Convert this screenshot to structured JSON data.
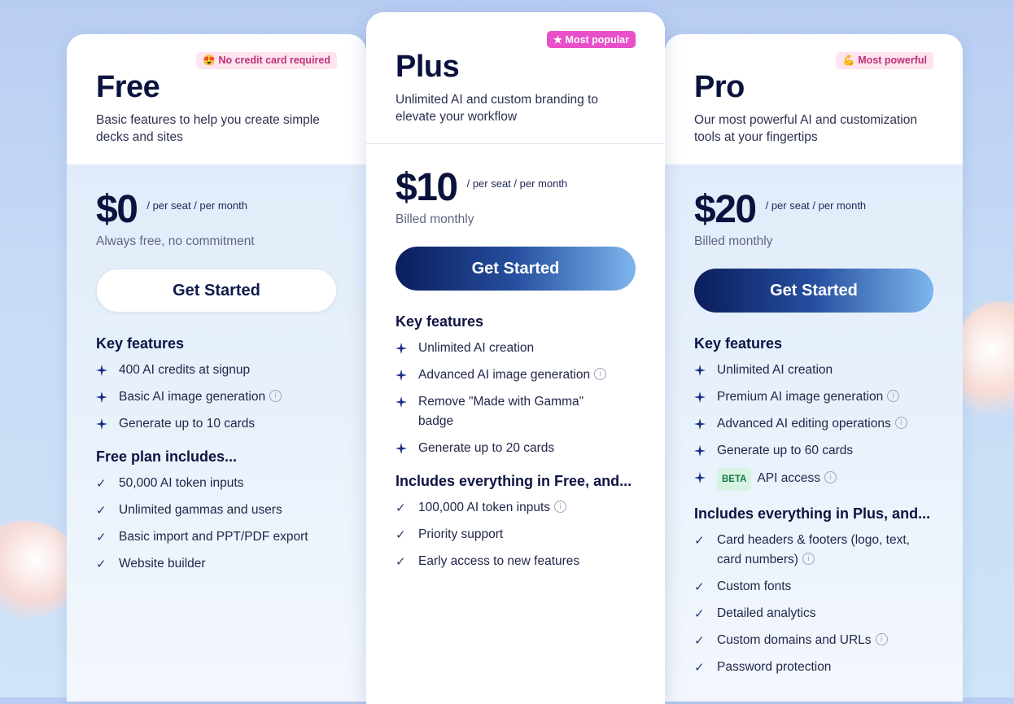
{
  "plans": [
    {
      "title": "Free",
      "badge": "😍 No credit card required",
      "description": "Basic features to help you create simple decks and sites",
      "price": "$0",
      "per": "/ per seat / per month",
      "billing": "Always free, no commitment",
      "cta": "Get Started",
      "key_features_heading": "Key features",
      "key_features": [
        "400 AI credits at signup",
        "Basic AI image generation",
        "Generate up to 10 cards"
      ],
      "includes_heading": "Free plan includes...",
      "includes": [
        "50,000 AI token inputs",
        "Unlimited gammas and users",
        "Basic import and PPT/PDF export",
        "Website builder"
      ]
    },
    {
      "title": "Plus",
      "badge": "★ Most popular",
      "description": "Unlimited AI and custom branding to elevate your workflow",
      "price": "$10",
      "per": "/ per seat / per month",
      "billing": "Billed monthly",
      "cta": "Get Started",
      "key_features_heading": "Key features",
      "key_features": [
        "Unlimited AI creation",
        "Advanced AI image generation",
        "Remove \"Made with Gamma\" badge",
        "Generate up to 20 cards"
      ],
      "includes_heading": "Includes everything in Free, and...",
      "includes": [
        "100,000 AI token inputs",
        "Priority support",
        "Early access to new features"
      ]
    },
    {
      "title": "Pro",
      "badge": "💪 Most powerful",
      "description": "Our most powerful AI and customization tools at your fingertips",
      "price": "$20",
      "per": "/ per seat / per month",
      "billing": "Billed monthly",
      "cta": "Get Started",
      "key_features_heading": "Key features",
      "key_features": [
        "Unlimited AI creation",
        "Premium AI image generation",
        "Advanced AI editing operations",
        "Generate up to 60 cards",
        "API access"
      ],
      "beta_label": "BETA",
      "includes_heading": "Includes everything in Plus, and...",
      "includes": [
        "Card headers & footers (logo, text, card numbers)",
        "Custom fonts",
        "Detailed analytics",
        "Custom domains and URLs",
        "Password protection"
      ]
    }
  ],
  "icons": {
    "sparkle": "sparkle-icon",
    "check": "check-icon",
    "info": "info-icon"
  },
  "colors": {
    "badge_free_bg": "#fde4ef",
    "badge_free_text": "#c0307a",
    "badge_plus_bg": "#e94fc8",
    "badge_plus_text": "#ffffff",
    "badge_pro_bg": "#fde4ef",
    "badge_pro_text": "#c0307a",
    "sparkle": "#1b2f86"
  }
}
